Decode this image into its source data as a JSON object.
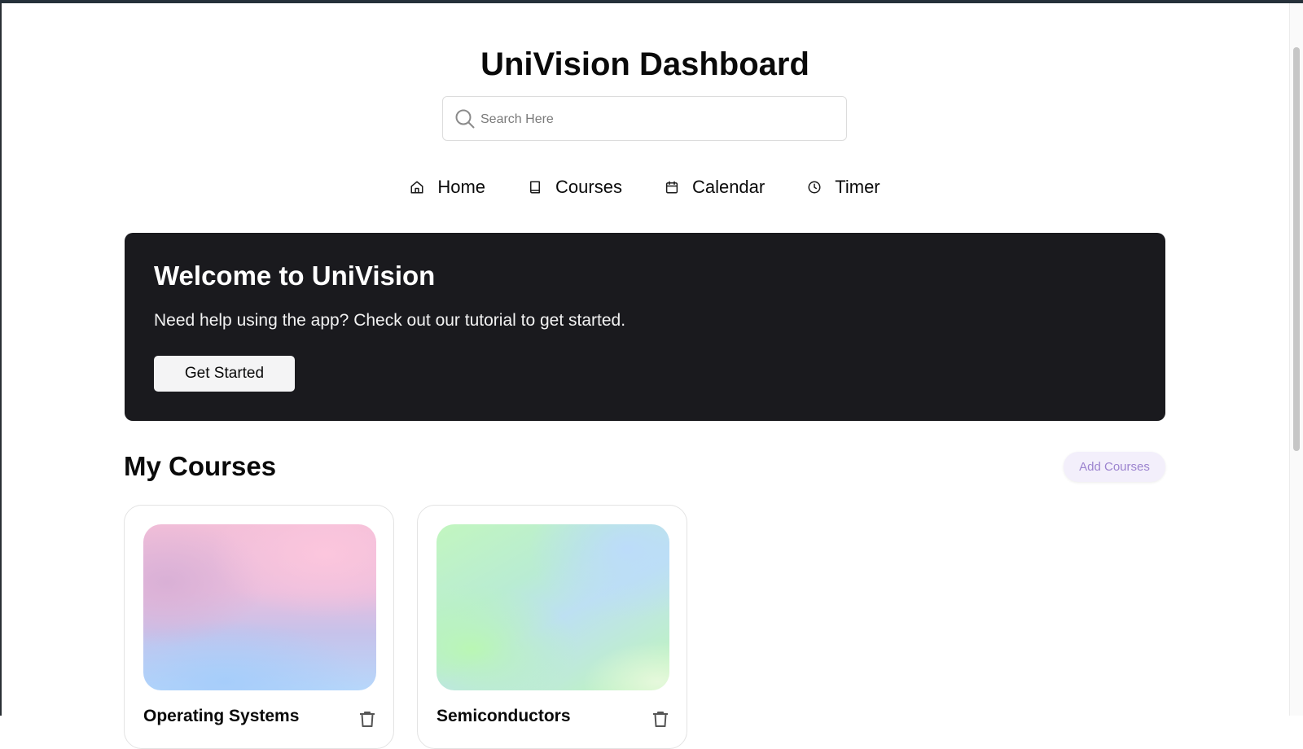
{
  "header": {
    "title": "UniVision Dashboard"
  },
  "search": {
    "placeholder": "Search Here",
    "icon": "search-icon"
  },
  "nav": {
    "items": [
      {
        "label": "Home",
        "icon": "home-icon"
      },
      {
        "label": "Courses",
        "icon": "book-icon"
      },
      {
        "label": "Calendar",
        "icon": "calendar-icon"
      },
      {
        "label": "Timer",
        "icon": "clock-icon"
      }
    ]
  },
  "hero": {
    "title": "Welcome to UniVision",
    "subtitle": "Need help using the app? Check out our tutorial to get started.",
    "button_label": "Get Started",
    "background": "#1a1a1e"
  },
  "courses": {
    "section_title": "My Courses",
    "add_label": "Add Courses",
    "add_color": "#9c83cf",
    "items": [
      {
        "title": "Operating Systems",
        "icon": "trash-icon"
      },
      {
        "title": "Semiconductors",
        "icon": "trash-icon"
      }
    ]
  }
}
